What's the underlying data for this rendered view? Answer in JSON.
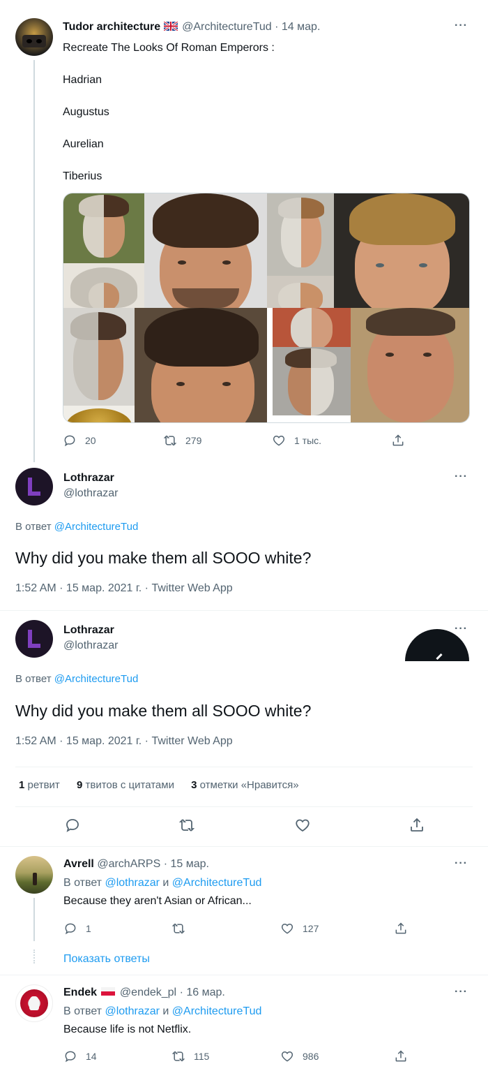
{
  "tweet1": {
    "author_name": "Tudor architecture",
    "handle": "@ArchitectureTud",
    "date": "· 14 мар.",
    "text_lines": [
      "Recreate The Looks Of Roman Emperors :",
      "Hadrian",
      "Augustus",
      "Aurelian",
      "Tiberius"
    ],
    "replies": "20",
    "retweets": "279",
    "likes": "1 тыс."
  },
  "reply1": {
    "author_name": "Lothrazar",
    "handle": "@lothrazar",
    "reply_prefix": "В ответ ",
    "reply_to": "@ArchitectureTud",
    "text": "Why did you make them all SOOO white?",
    "meta": "1:52 AM · 15 мар. 2021 г. · Twitter Web App"
  },
  "focused": {
    "author_name": "Lothrazar",
    "handle": "@lothrazar",
    "reply_prefix": "В ответ ",
    "reply_to": "@ArchitectureTud",
    "text": "Why did you make them all SOOO white?",
    "meta": "1:52 AM · 15 мар. 2021 г. · Twitter Web App",
    "stats": {
      "retweets_count": "1",
      "retweets_label": "ретвит",
      "quotes_count": "9",
      "quotes_label": "твитов с цитатами",
      "likes_count": "3",
      "likes_label": "отметки «Нравится»"
    }
  },
  "avrell": {
    "author_name": "Avrell",
    "handle": "@archARPS",
    "date": "· 15 мар.",
    "reply_prefix": "В ответ ",
    "reply_to_1": "@lothrazar",
    "conj": " и ",
    "reply_to_2": "@ArchitectureTud",
    "text": "Because they aren't Asian or African...",
    "replies": "1",
    "retweets": "",
    "likes": "127",
    "show_replies": "Показать ответы"
  },
  "endek": {
    "author_name": "Endek",
    "handle": "@endek_pl",
    "date": "· 16 мар.",
    "reply_prefix": "В ответ ",
    "reply_to_1": "@lothrazar",
    "conj": " и ",
    "reply_to_2": "@ArchitectureTud",
    "text": "Because life is not Netflix.",
    "replies": "14",
    "retweets": "115",
    "likes": "986"
  },
  "colors": {
    "link": "#1d9bf0",
    "muted": "#536471",
    "text": "#0f1419",
    "divider": "#eff3f4"
  },
  "icons": [
    "more-icon",
    "reply-icon",
    "retweet-icon",
    "like-icon",
    "share-icon",
    "uk-flag-icon",
    "poland-flag-icon",
    "compose-icon"
  ]
}
